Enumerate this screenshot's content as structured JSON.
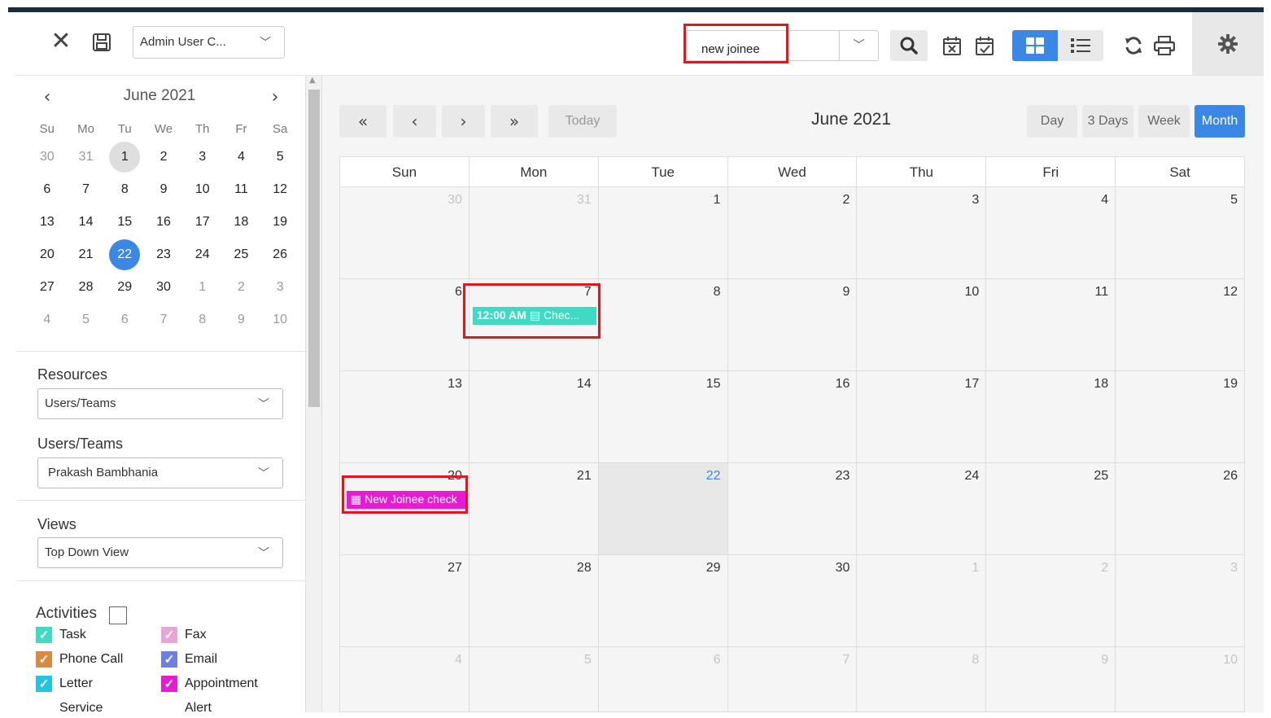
{
  "toolbar": {
    "view_selector": "Admin User C...",
    "search_value": "new joinee",
    "search_placeholder": ""
  },
  "mini_calendar": {
    "title": "June 2021",
    "dow": [
      "Su",
      "Mo",
      "Tu",
      "We",
      "Th",
      "Fr",
      "Sa"
    ],
    "weeks": [
      [
        "30",
        "31",
        "1",
        "2",
        "3",
        "4",
        "5"
      ],
      [
        "6",
        "7",
        "8",
        "9",
        "10",
        "11",
        "12"
      ],
      [
        "13",
        "14",
        "15",
        "16",
        "17",
        "18",
        "19"
      ],
      [
        "20",
        "21",
        "22",
        "23",
        "24",
        "25",
        "26"
      ],
      [
        "27",
        "28",
        "29",
        "30",
        "1",
        "2",
        "3"
      ],
      [
        "4",
        "5",
        "6",
        "7",
        "8",
        "9",
        "10"
      ]
    ]
  },
  "sidebar": {
    "resources_label": "Resources",
    "resources_value": "Users/Teams",
    "users_label": "Users/Teams",
    "users_value": "Prakash Bambhania",
    "views_label": "Views",
    "views_value": "Top Down View",
    "activities_label": "Activities",
    "activities": [
      {
        "label": "Task",
        "color": "#40d9c2",
        "kind": "check"
      },
      {
        "label": "Fax",
        "color": "#e8a6d6",
        "kind": "check"
      },
      {
        "label": "Phone Call",
        "color": "#d98a3f",
        "kind": "check"
      },
      {
        "label": "Email",
        "color": "#6f7fe0",
        "kind": "check"
      },
      {
        "label": "Letter",
        "color": "#22c4e0",
        "kind": "check"
      },
      {
        "label": "Appointment",
        "color": "#e81bd5",
        "kind": "check"
      },
      {
        "label": "Service",
        "color": "#e81b2b",
        "kind": "bar"
      },
      {
        "label": "Alert",
        "color": "#1f9e2f",
        "kind": "bar"
      }
    ]
  },
  "main": {
    "title": "June 2021",
    "today_label": "Today",
    "views": [
      "Day",
      "3 Days",
      "Week",
      "Month"
    ],
    "active_view": "Month",
    "headers": [
      "Sun",
      "Mon",
      "Tue",
      "Wed",
      "Thu",
      "Fri",
      "Sat"
    ],
    "weeks": [
      [
        "30",
        "31",
        "1",
        "2",
        "3",
        "4",
        "5"
      ],
      [
        "6",
        "7",
        "8",
        "9",
        "10",
        "11",
        "12"
      ],
      [
        "13",
        "14",
        "15",
        "16",
        "17",
        "18",
        "19"
      ],
      [
        "20",
        "21",
        "22",
        "23",
        "24",
        "25",
        "26"
      ],
      [
        "27",
        "28",
        "29",
        "30",
        "1",
        "2",
        "3"
      ],
      [
        "4",
        "5",
        "6",
        "7",
        "8",
        "9",
        "10"
      ]
    ],
    "events": {
      "task_time": "12:00 AM",
      "task_title": "Chec...",
      "appt_title": "New Joinee check"
    }
  },
  "colors": {
    "accent": "#3a87e6",
    "highlight": "#e8141b",
    "task": "#40d9c2",
    "appointment": "#e81bd5"
  }
}
